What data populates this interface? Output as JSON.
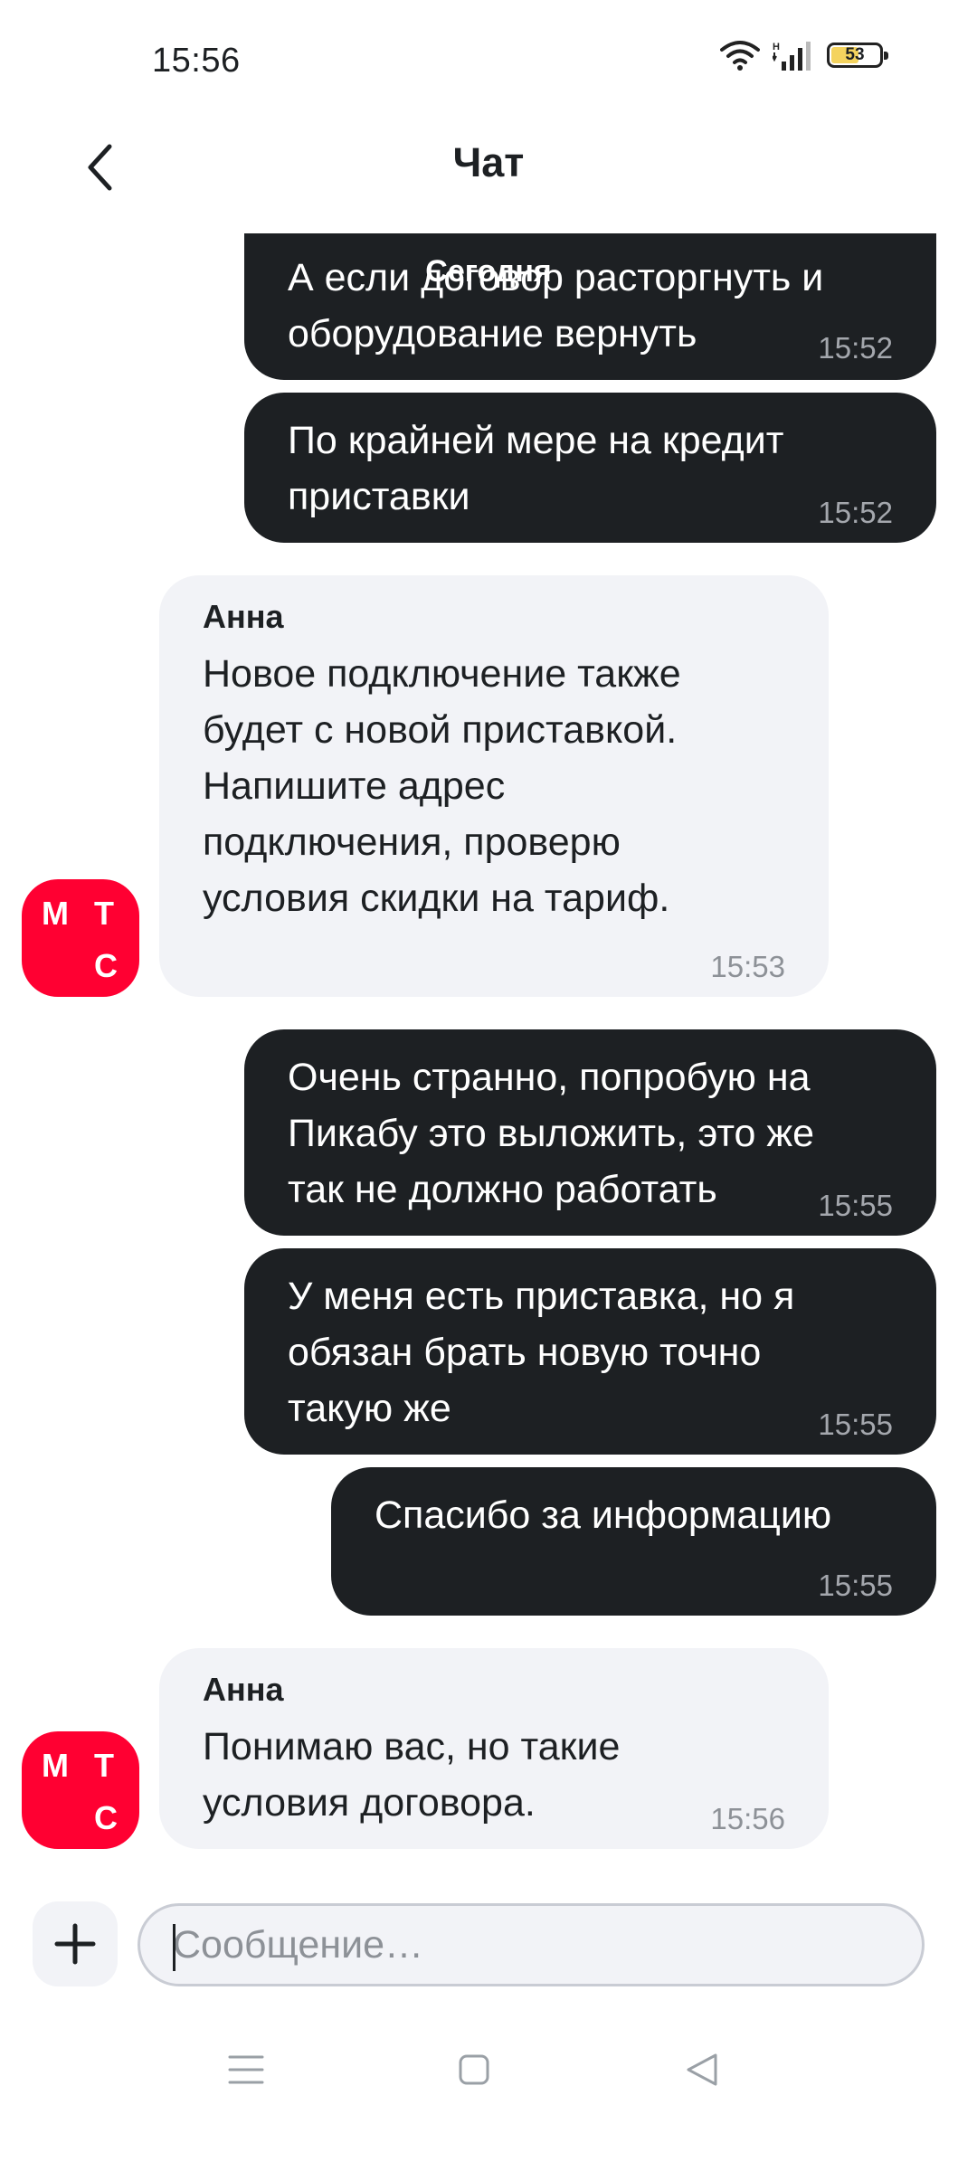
{
  "status_bar": {
    "time": "15:56",
    "battery_level": "53"
  },
  "header": {
    "title": "Чат",
    "back_icon": "chevron-left-icon"
  },
  "date_divider": "Сегодня",
  "messages": [
    {
      "direction": "out",
      "lines": [
        "А если договор расторгнуть и",
        "оборудование вернуть"
      ],
      "time": "15:52"
    },
    {
      "direction": "out",
      "lines": [
        "По крайней мере на кредит",
        "приставки"
      ],
      "time": "15:52"
    },
    {
      "direction": "in",
      "sender": "Анна",
      "lines": [
        "Новое подключение также",
        "будет с новой приставкой.",
        "Напишите адрес",
        "подключения, проверю",
        "условия скидки на тариф."
      ],
      "time": "15:53"
    },
    {
      "direction": "out",
      "lines": [
        "Очень странно, попробую на",
        "Пикабу это выложить, это же",
        "так не должно работать"
      ],
      "time": "15:55"
    },
    {
      "direction": "out",
      "lines": [
        "У меня есть приставка, но я",
        "обязан брать новую точно",
        "такую же"
      ],
      "time": "15:55"
    },
    {
      "direction": "out",
      "lines": [
        "Спасибо за информацию"
      ],
      "time": "15:55"
    },
    {
      "direction": "in",
      "sender": "Анна",
      "lines": [
        "Понимаю вас, но такие",
        "условия договора."
      ],
      "time": "15:56"
    }
  ],
  "avatar": {
    "letters": [
      "М",
      "Т",
      "С"
    ],
    "color": "#ff0032"
  },
  "composer": {
    "placeholder": "Сообщение…",
    "attach_icon": "plus-icon"
  },
  "nav_bar": {
    "icons": [
      "menu-icon",
      "home-square-icon",
      "back-triangle-icon"
    ]
  },
  "colors": {
    "outgoing_bubble": "#1d2023",
    "incoming_bubble": "#f2f3f7",
    "accent": "#ff0032"
  }
}
